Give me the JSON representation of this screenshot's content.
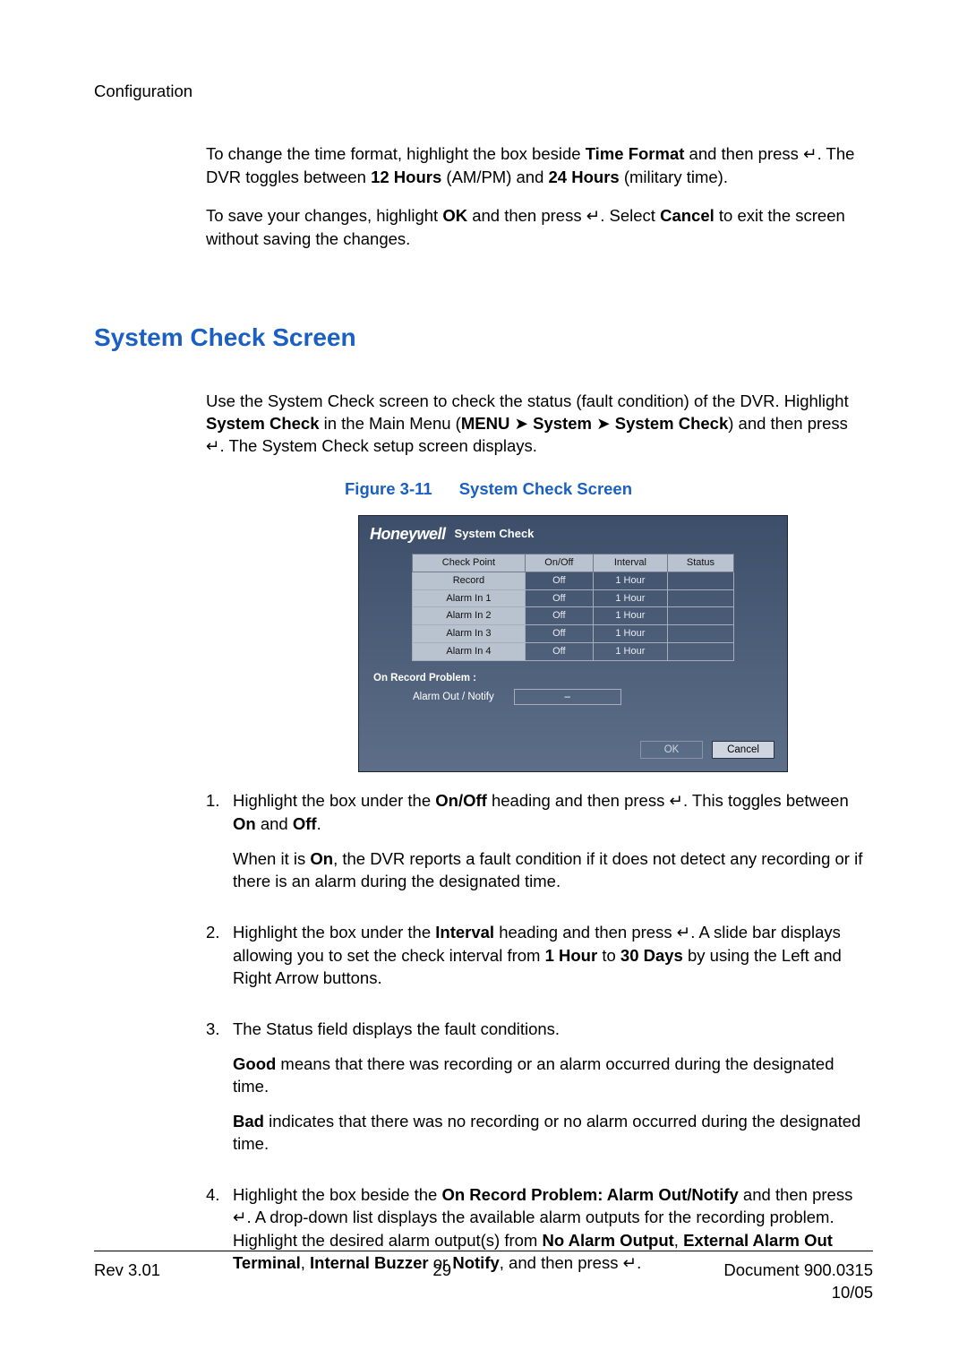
{
  "header": "Configuration",
  "enter_char": "↵",
  "intro": {
    "p1a": "To change the time format, highlight the box beside ",
    "b1": "Time Format",
    "p1b": " and then press ",
    "p1c": ". The DVR toggles between ",
    "b2": "12 Hours",
    "p1d": " (AM/PM) and ",
    "b3": "24 Hours",
    "p1e": " (military time).",
    "p2a": "To save your changes, highlight ",
    "b4": "OK",
    "p2b": " and then press ",
    "p2c": ". Select ",
    "b5": "Cancel",
    "p2d": " to exit the screen without saving the changes."
  },
  "section_title": "System Check Screen",
  "section": {
    "p1a": "Use the System Check screen to check the status (fault condition) of the DVR. Highlight ",
    "b1": "System Check",
    "p1b": " in the Main Menu (",
    "b2": "MENU",
    "arrow": "➤",
    "b3": "System",
    "b4": "System Check",
    "p1c": ") and then press ",
    "p1d": ". The System Check setup screen displays."
  },
  "figure": {
    "label": "Figure 3-11",
    "title": "System Check Screen"
  },
  "screenshot": {
    "brand": "Honeywell",
    "subtitle": "System Check",
    "cols": [
      "Check Point",
      "On/Off",
      "Interval",
      "Status"
    ],
    "rows": [
      {
        "name": "Record",
        "onoff": "Off",
        "interval": "1 Hour",
        "status": ""
      },
      {
        "name": "Alarm In 1",
        "onoff": "Off",
        "interval": "1 Hour",
        "status": ""
      },
      {
        "name": "Alarm In 2",
        "onoff": "Off",
        "interval": "1 Hour",
        "status": ""
      },
      {
        "name": "Alarm In 3",
        "onoff": "Off",
        "interval": "1 Hour",
        "status": ""
      },
      {
        "name": "Alarm In 4",
        "onoff": "Off",
        "interval": "1 Hour",
        "status": ""
      }
    ],
    "subhead": "On Record Problem :",
    "notify_label": "Alarm Out / Notify",
    "notify_value": "–",
    "ok": "OK",
    "cancel": "Cancel"
  },
  "steps": [
    {
      "num": "1.",
      "parts": [
        {
          "t": "Highlight the box under the "
        },
        {
          "b": "On/Off"
        },
        {
          "t": " heading and then press "
        },
        {
          "enter": true
        },
        {
          "t": ". This toggles between "
        },
        {
          "b": "On"
        },
        {
          "t": " and "
        },
        {
          "b": "Off"
        },
        {
          "t": "."
        }
      ],
      "extra": [
        {
          "t": "When it is "
        },
        {
          "b": "On"
        },
        {
          "t": ", the DVR reports a fault condition if it does not detect any recording or if there is an alarm during the designated time."
        }
      ]
    },
    {
      "num": "2.",
      "parts": [
        {
          "t": "Highlight the box under the "
        },
        {
          "b": "Interval"
        },
        {
          "t": " heading and then press "
        },
        {
          "enter": true
        },
        {
          "t": ". A slide bar displays allowing you to set the check interval from "
        },
        {
          "b": "1 Hour"
        },
        {
          "t": " to "
        },
        {
          "b": "30 Days"
        },
        {
          "t": " by using the Left and Right Arrow buttons."
        }
      ]
    },
    {
      "num": "3.",
      "parts": [
        {
          "t": "The Status field displays the fault conditions."
        }
      ],
      "extra": [
        {
          "b": "Good"
        },
        {
          "t": " means that there was recording or an alarm occurred during the designated time."
        }
      ],
      "extra2": [
        {
          "b": "Bad"
        },
        {
          "t": " indicates that there was no recording or no alarm occurred during the designated time."
        }
      ]
    },
    {
      "num": "4.",
      "parts": [
        {
          "t": "Highlight the box beside the "
        },
        {
          "b": "On Record Problem: Alarm Out/Notify"
        },
        {
          "t": " and then press "
        },
        {
          "enter": true
        },
        {
          "t": ". A drop-down list displays the available alarm outputs for the recording problem. Highlight the desired alarm output(s) from "
        },
        {
          "b": "No Alarm Output"
        },
        {
          "t": ", "
        },
        {
          "b": "External Alarm Out Terminal"
        },
        {
          "t": ", "
        },
        {
          "b": "Internal Buzzer"
        },
        {
          "t": " or "
        },
        {
          "b": "Notify"
        },
        {
          "t": ", and then press "
        },
        {
          "enter": true
        },
        {
          "t": "."
        }
      ]
    }
  ],
  "footer": {
    "left": "Rev 3.01",
    "center": "29",
    "right1": "Document 900.0315",
    "right2": "10/05"
  }
}
